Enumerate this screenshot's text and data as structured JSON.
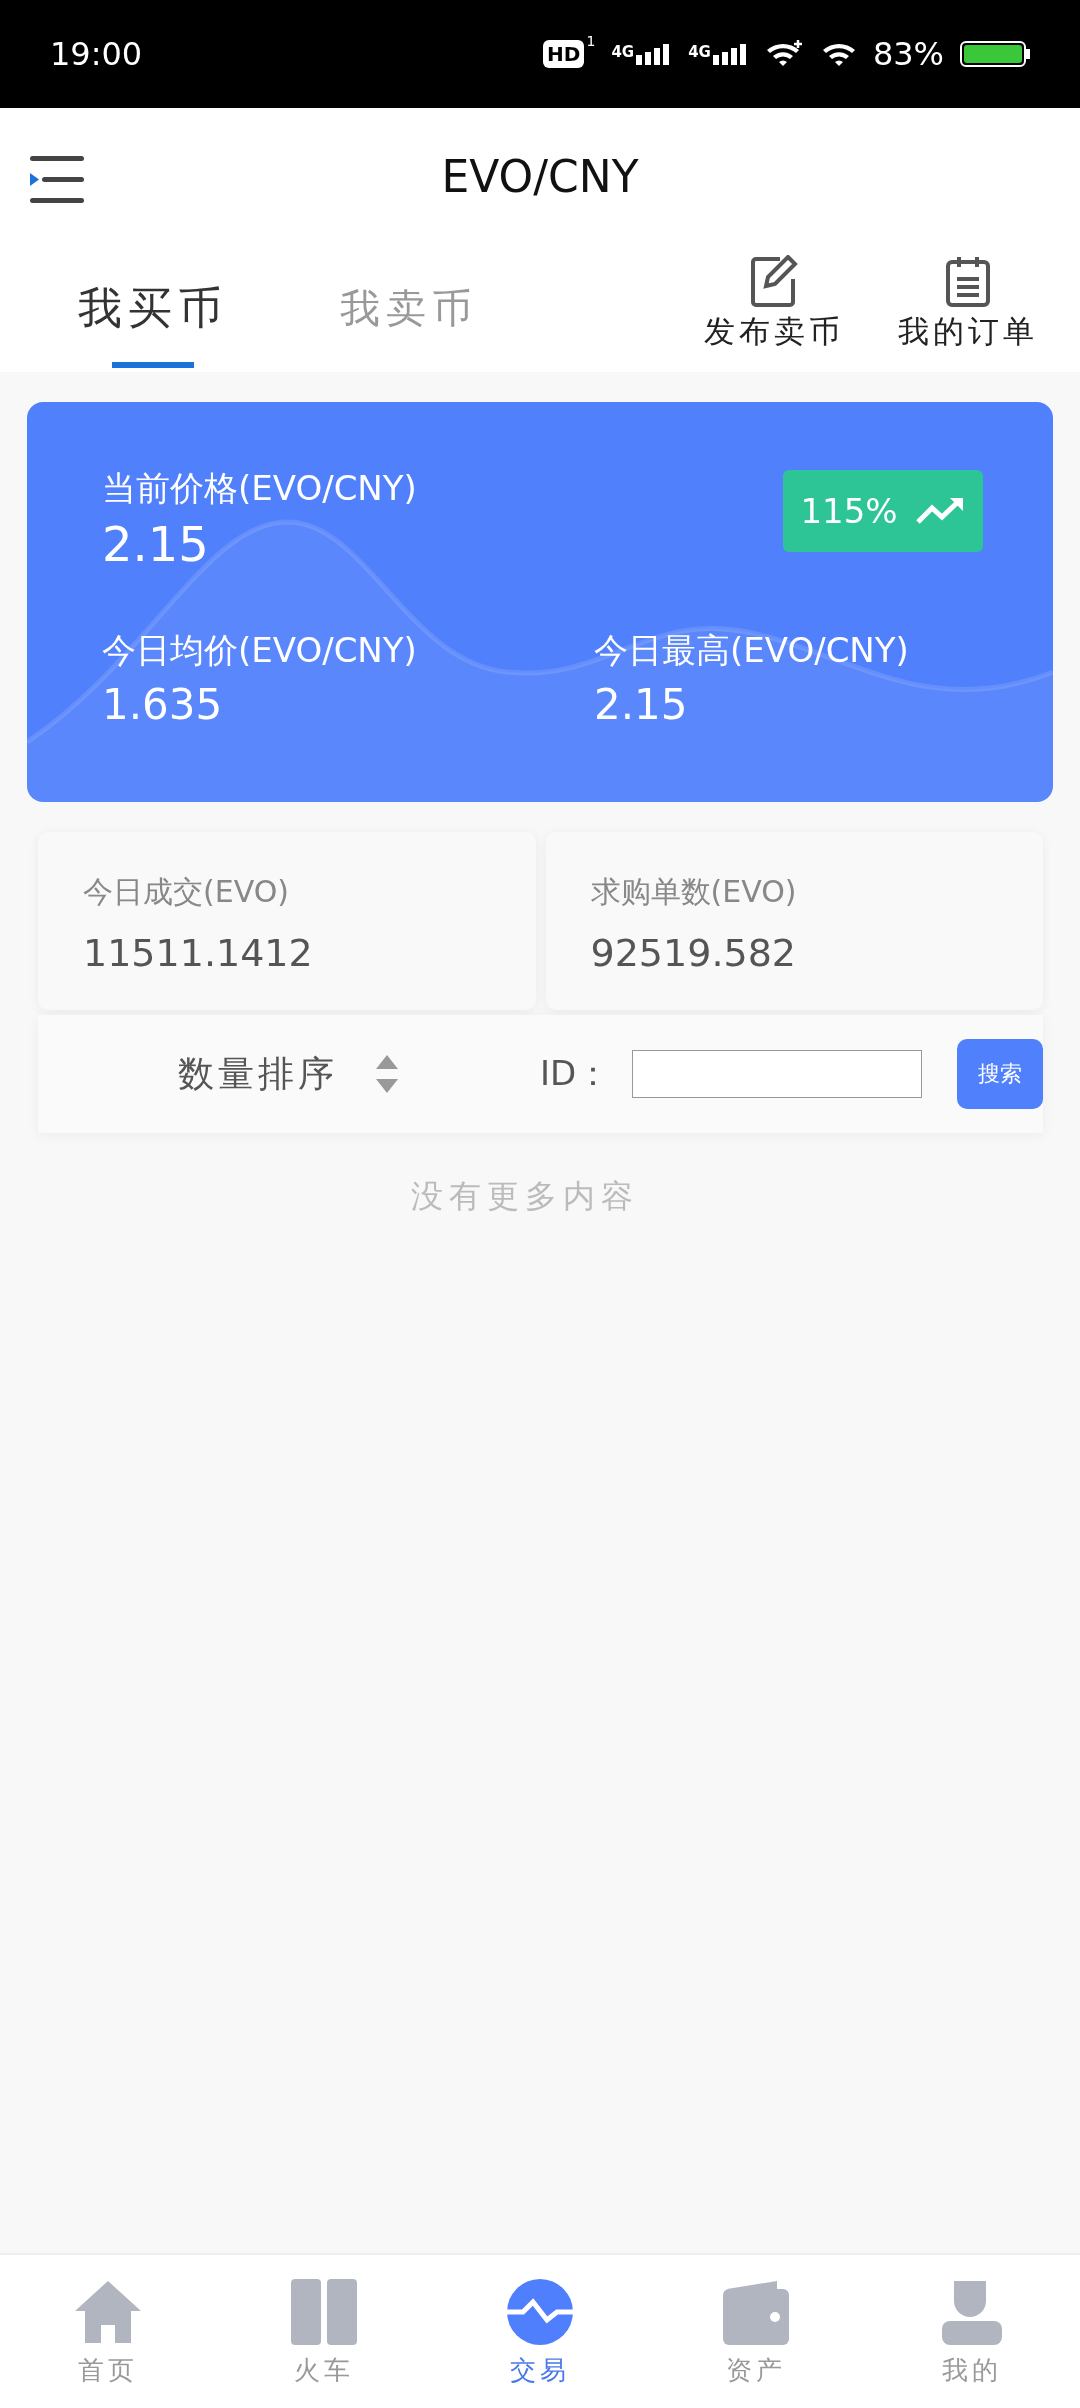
{
  "status_bar": {
    "time": "19:00",
    "hd": "HD",
    "sim": "1",
    "networks": [
      "4G",
      "4G"
    ],
    "battery": "83%"
  },
  "header": {
    "title": "EVO/CNY"
  },
  "tabs": [
    {
      "label": "我买币",
      "selected": true
    },
    {
      "label": "我卖币",
      "selected": false
    }
  ],
  "actions": [
    {
      "label": "发布卖币",
      "kind": "edit"
    },
    {
      "label": "我的订单",
      "kind": "list"
    }
  ],
  "price_card": {
    "label": "当前价格(EVO/CNY)",
    "value": "2.15",
    "change": "115%",
    "stats": [
      {
        "label": "今日均价(EVO/CNY)",
        "value": "1.635"
      },
      {
        "label": "今日最高(EVO/CNY)",
        "value": "2.15"
      }
    ]
  },
  "summary": [
    {
      "label": "今日成交(EVO)",
      "value": "11511.1412"
    },
    {
      "label": "求购单数(EVO)",
      "value": "92519.582"
    }
  ],
  "filter": {
    "sort_label": "数量排序",
    "id_label": "ID：",
    "search_button": "搜索"
  },
  "empty_message": "没有更多内容",
  "nav": [
    {
      "label": "首页",
      "kind": "home",
      "selected": false
    },
    {
      "label": "火车",
      "kind": "doors",
      "selected": false
    },
    {
      "label": "交易",
      "kind": "trade",
      "selected": true
    },
    {
      "label": "资产",
      "kind": "wallet",
      "selected": false
    },
    {
      "label": "我的",
      "kind": "user",
      "selected": false
    }
  ]
}
